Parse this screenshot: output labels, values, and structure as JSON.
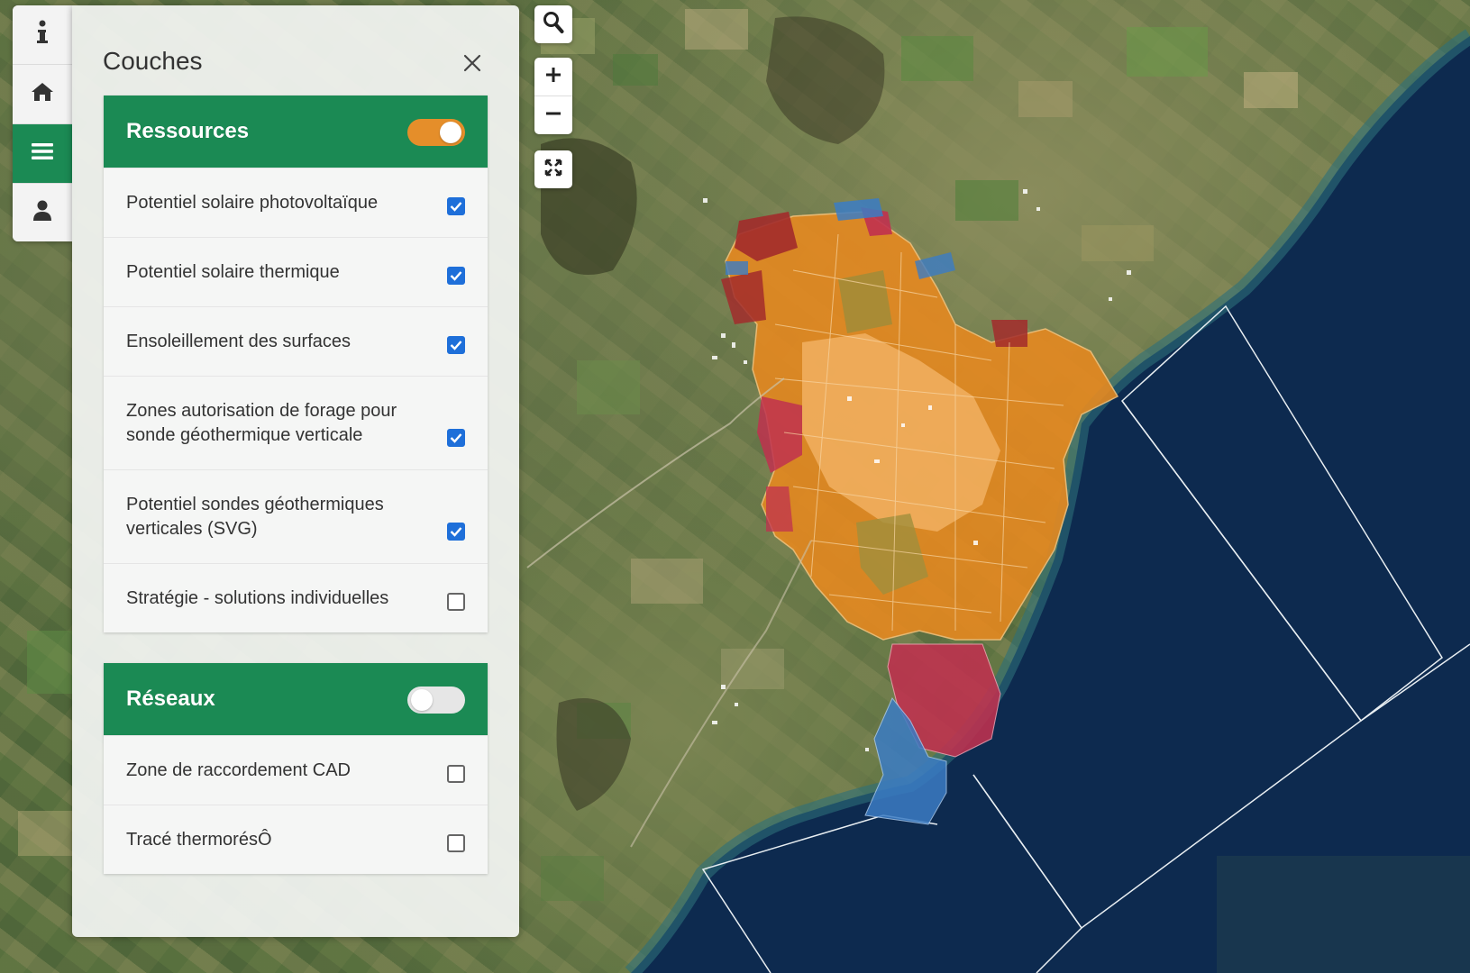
{
  "sidebar": {
    "items": [
      {
        "icon": "info-icon",
        "active": false
      },
      {
        "icon": "home-icon",
        "active": false
      },
      {
        "icon": "menu-icon",
        "active": true
      },
      {
        "icon": "user-icon",
        "active": false
      }
    ]
  },
  "panel": {
    "title": "Couches",
    "groups": [
      {
        "title": "Ressources",
        "enabled": true,
        "layers": [
          {
            "label": "Potentiel solaire photovoltaïque",
            "checked": true
          },
          {
            "label": "Potentiel solaire thermique",
            "checked": true
          },
          {
            "label": "Ensoleillement des surfaces",
            "checked": true
          },
          {
            "label": "Zones autorisation de forage pour sonde géothermique verticale",
            "checked": true
          },
          {
            "label": "Potentiel sondes géothermiques verticales (SVG)",
            "checked": true
          },
          {
            "label": "Stratégie - solutions individuelles",
            "checked": false
          }
        ]
      },
      {
        "title": "Réseaux",
        "enabled": false,
        "layers": [
          {
            "label": "Zone de raccordement CAD",
            "checked": false
          },
          {
            "label": "Tracé thermorésÔ",
            "checked": false
          }
        ]
      }
    ]
  },
  "map_controls": {
    "search": "search-icon",
    "zoom_in": "zoom-in-icon",
    "zoom_out": "zoom-out-icon",
    "fullscreen": "fullscreen-icon"
  },
  "colors": {
    "accent_green": "#1b8a54",
    "toggle_orange": "#e58e2a",
    "checkbox_blue": "#1e6fd9",
    "lake": "#0d2a4f",
    "zone_orange": "#e8891f",
    "zone_red": "#c0314f",
    "zone_blue": "#3b7cc4"
  }
}
